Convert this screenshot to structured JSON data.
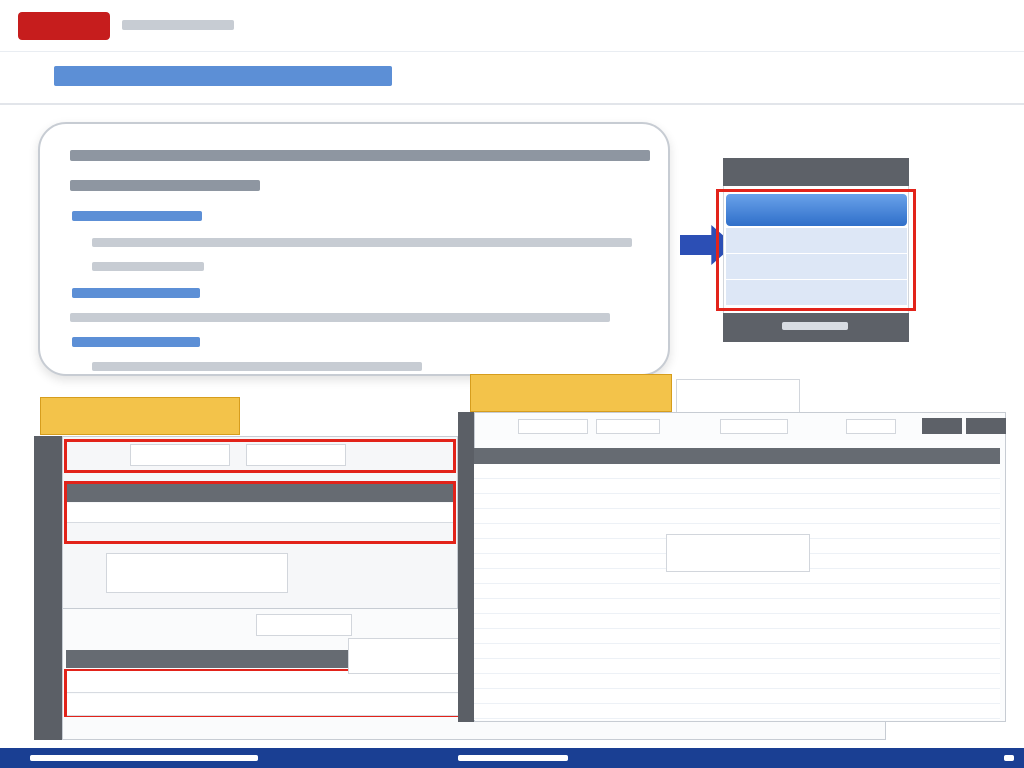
{
  "slide": {
    "visible_text_count": 0
  }
}
